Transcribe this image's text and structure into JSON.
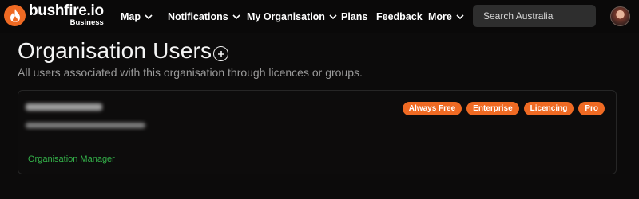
{
  "brand": {
    "name": "bushfire.io",
    "sub": "Business",
    "accent": "#ef6a23"
  },
  "nav": {
    "items": [
      {
        "label": "Map",
        "dropdown": true
      },
      {
        "label": "Notifications",
        "dropdown": true
      },
      {
        "label": "My Organisation",
        "dropdown": true
      },
      {
        "label": "Plans",
        "dropdown": false
      },
      {
        "label": "Feedback",
        "dropdown": false
      },
      {
        "label": "More",
        "dropdown": true
      }
    ],
    "search": {
      "placeholder": "Search Australia",
      "value": ""
    }
  },
  "page": {
    "title": "Organisation Users",
    "subtitle": "All users associated with this organisation through licences or groups."
  },
  "users": [
    {
      "badges": [
        "Always Free",
        "Enterprise",
        "Licencing",
        "Pro"
      ],
      "role": "Organisation Manager",
      "role_color": "#34b24a"
    }
  ]
}
